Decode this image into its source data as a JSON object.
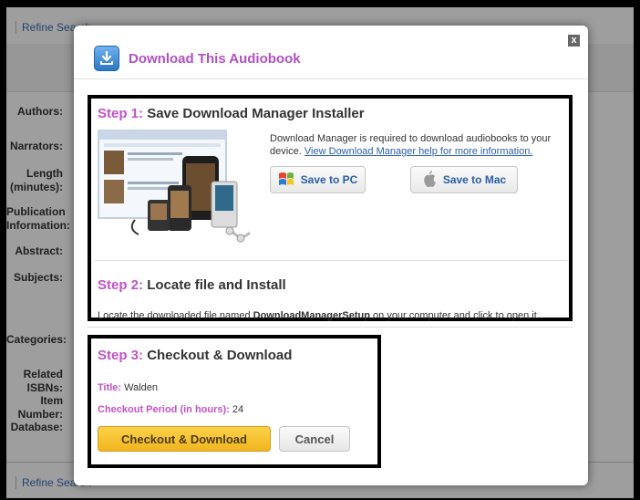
{
  "background": {
    "refine_top": "Refine Search",
    "refine_bottom": "Refine Search",
    "labels": [
      "Authors:",
      "Narrators:",
      "Length (minutes):",
      "Publication Information:",
      "Abstract:",
      "Subjects:",
      "Categories:",
      "Related ISBNs:",
      "Item Number:",
      "Database:"
    ]
  },
  "modal": {
    "title": "Download This Audiobook",
    "close_label": "x",
    "step1": {
      "label": "Step 1:",
      "title": "Save Download Manager Installer",
      "description": "Download Manager is required to download audiobooks to your device.",
      "help_link": "View Download Manager help for more information.",
      "save_pc": "Save to PC",
      "save_mac": "Save to Mac"
    },
    "step2": {
      "label": "Step 2:",
      "title": "Locate file and Install",
      "text_before": "Locate the downloaded file named ",
      "filename": "DownloadManagerSetup",
      "text_after": " on your computer and click to open it."
    },
    "step3": {
      "label": "Step 3:",
      "title": "Checkout & Download",
      "title_key": "Title:",
      "title_value": "Walden",
      "period_key": "Checkout Period (in hours):",
      "period_value": "24",
      "checkout_button": "Checkout & Download",
      "cancel_button": "Cancel"
    }
  },
  "colors": {
    "accent": "#c251c8",
    "link": "#2a5ea8",
    "checkout_button": "#f2b51e"
  }
}
